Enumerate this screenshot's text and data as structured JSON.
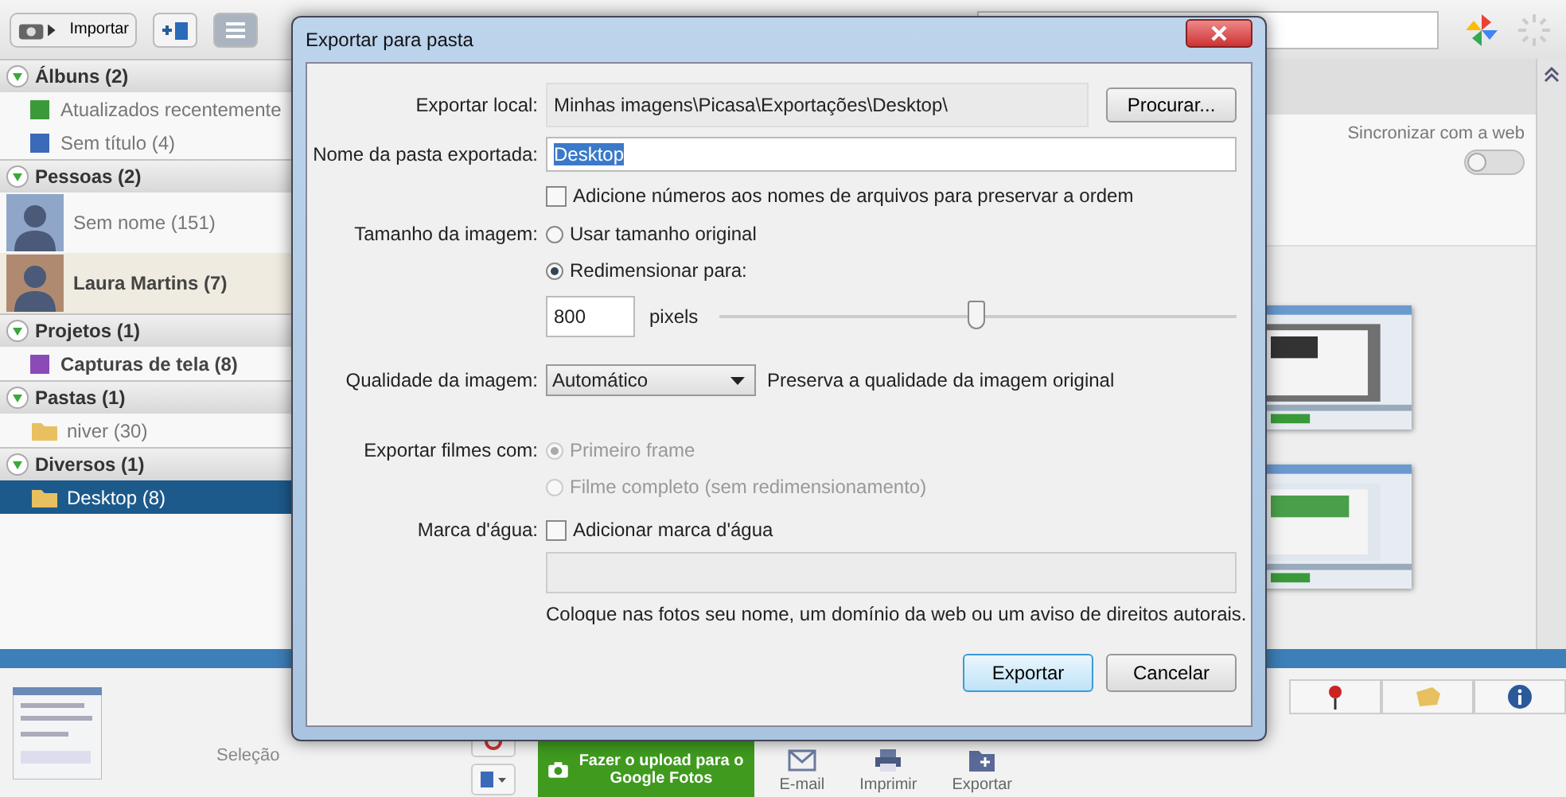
{
  "toolbar": {
    "import_button": "Importar"
  },
  "sidebar": {
    "sections": [
      {
        "title": "Álbuns (2)",
        "expanded": true,
        "items": [
          {
            "label": "Atualizados recentemente",
            "kind": "album",
            "bold": false,
            "selected": false,
            "color": "#3a9a3a"
          },
          {
            "label": "Sem título (4)",
            "kind": "album",
            "bold": false,
            "selected": false,
            "color": "#3a6ab8"
          }
        ]
      },
      {
        "title": "Pessoas (2)",
        "expanded": true,
        "items": [
          {
            "label": "Sem nome (151)",
            "kind": "person",
            "bold": false,
            "selected": false
          },
          {
            "label": "Laura Martins (7)",
            "kind": "person",
            "bold": true,
            "selected": false
          }
        ]
      },
      {
        "title": "Projetos (1)",
        "expanded": true,
        "items": [
          {
            "label": "Capturas de tela (8)",
            "kind": "album",
            "bold": true,
            "selected": false,
            "color": "#8a4ab8"
          }
        ]
      },
      {
        "title": "Pastas (1)",
        "expanded": true,
        "items": [
          {
            "label": "niver (30)",
            "kind": "folder",
            "bold": false,
            "selected": false
          }
        ]
      },
      {
        "title": "Diversos (1)",
        "expanded": true,
        "items": [
          {
            "label": "Desktop (8)",
            "kind": "folder",
            "bold": false,
            "selected": true
          }
        ]
      }
    ]
  },
  "sync": {
    "label": "Sincronizar com a web",
    "on": false
  },
  "tray": {
    "label": "Seleção"
  },
  "upload_button": "Fazer o upload para o Google Fotos",
  "actions": [
    {
      "label": "E-mail",
      "kind": "mail"
    },
    {
      "label": "Imprimir",
      "kind": "print"
    },
    {
      "label": "Exportar",
      "kind": "export"
    }
  ],
  "dialog": {
    "title": "Exportar para pasta",
    "location_label": "Exportar local:",
    "location": "Minhas imagens\\Picasa\\Exportações\\Desktop\\",
    "browse_button": "Procurar...",
    "folder_label": "Nome da pasta exportada:",
    "folder_name": "Desktop",
    "numbering": {
      "label": "Adicione números aos nomes de arquivos para preservar a ordem",
      "checked": false
    },
    "size_label": "Tamanho da imagem:",
    "size_options": [
      {
        "label": "Usar tamanho original",
        "selected": false
      },
      {
        "label": "Redimensionar para:",
        "selected": true
      }
    ],
    "pixels": "800",
    "pixels_unit": "pixels",
    "size_slider": {
      "level": 0.5
    },
    "quality_label": "Qualidade da imagem:",
    "quality": "Automático",
    "quality_note": "Preserva a qualidade da imagem original",
    "movies_label": "Exportar filmes com:",
    "movie_options": [
      {
        "label": "Primeiro frame",
        "selected": true,
        "disabled": true
      },
      {
        "label": "Filme completo (sem redimensionamento)",
        "selected": false,
        "disabled": true
      }
    ],
    "watermark_label": "Marca d'água:",
    "watermark": {
      "label": "Adicionar marca d'água",
      "checked": false
    },
    "watermark_hint": "Coloque nas fotos seu nome, um domínio da web ou um aviso de direitos autorais.",
    "buttons": [
      {
        "label": "Exportar",
        "kind": "primary"
      },
      {
        "label": "Cancelar",
        "kind": "secondary"
      }
    ]
  }
}
